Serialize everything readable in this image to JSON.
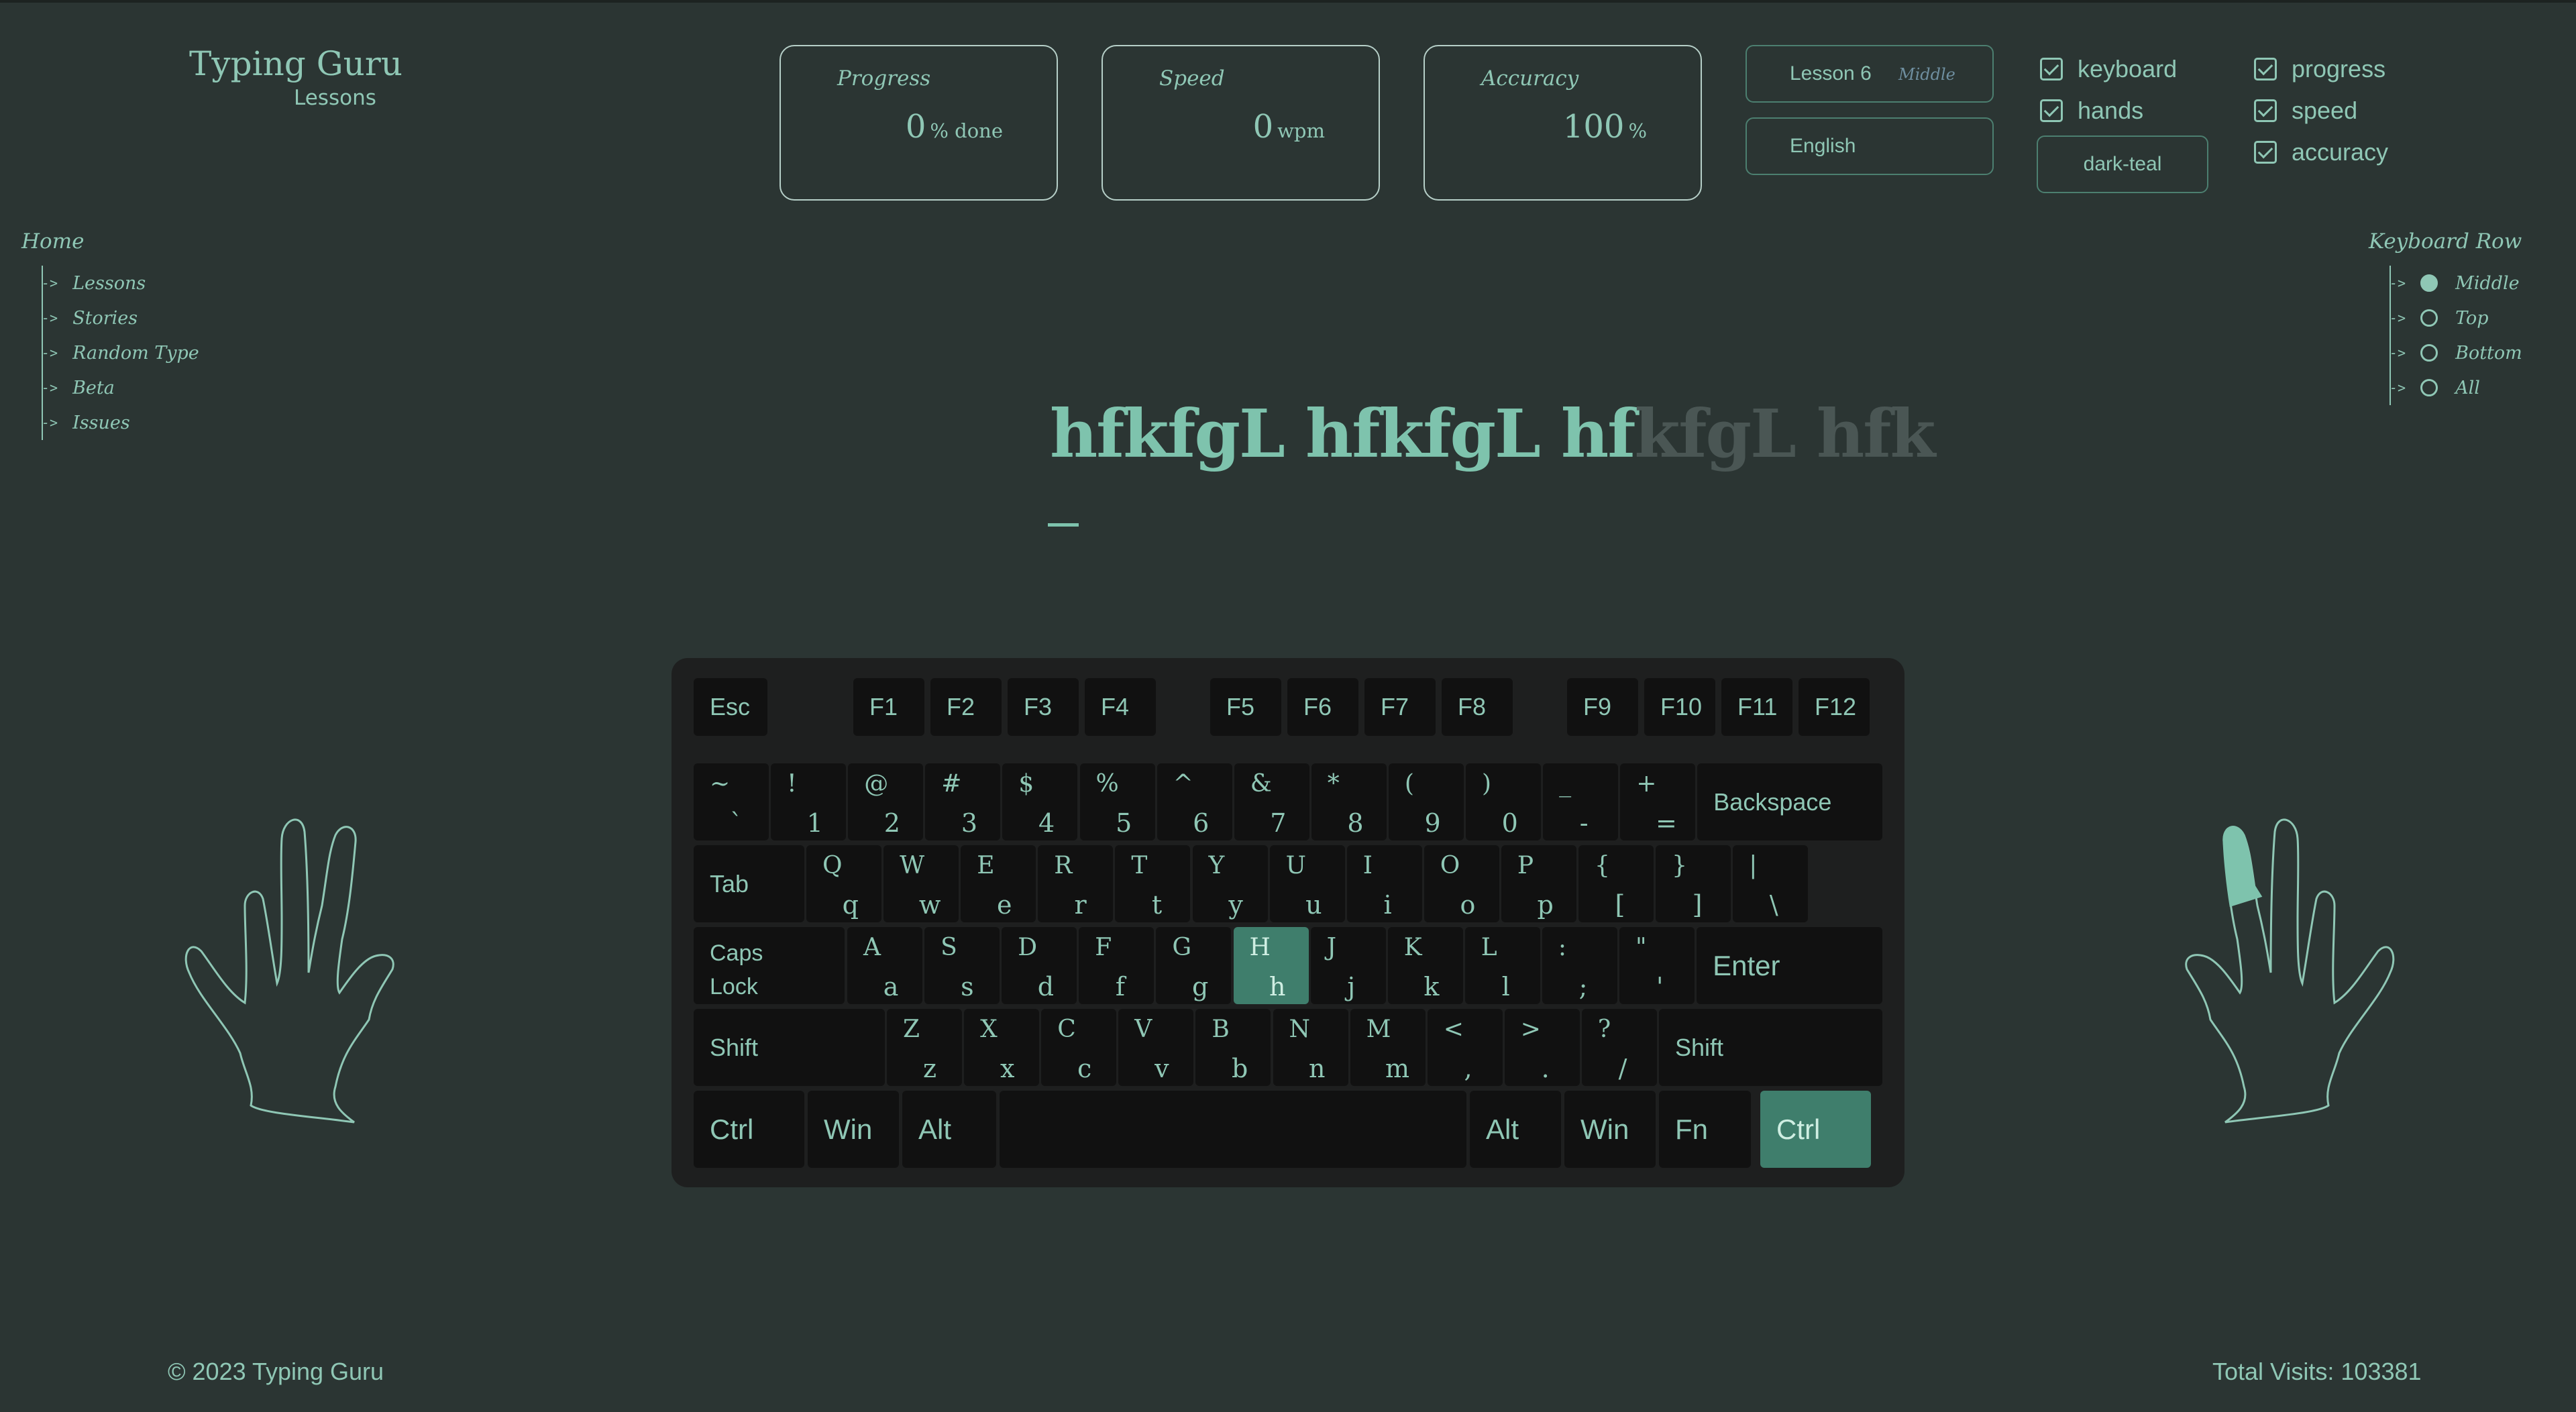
{
  "brand": {
    "title": "Typing Guru",
    "subtitle": "Lessons"
  },
  "stats": [
    {
      "label": "Progress",
      "value": "0",
      "unit": "% done"
    },
    {
      "label": "Speed",
      "value": "0",
      "unit": "wpm"
    },
    {
      "label": "Accuracy",
      "value": "100",
      "unit": "%"
    }
  ],
  "lesson": {
    "name": "Lesson 6",
    "row": "Middle",
    "language": "English",
    "theme": "dark-teal"
  },
  "toggles": {
    "col1": [
      {
        "label": "keyboard",
        "checked": true
      },
      {
        "label": "hands",
        "checked": true
      }
    ],
    "col2": [
      {
        "label": "progress",
        "checked": true
      },
      {
        "label": "speed",
        "checked": true
      },
      {
        "label": "accuracy",
        "checked": true
      }
    ]
  },
  "nav": {
    "title": "Home",
    "items": [
      "Lessons",
      "Stories",
      "Random Type",
      "Beta",
      "Issues"
    ]
  },
  "keyboard_row": {
    "title": "Keyboard Row",
    "options": [
      "Middle",
      "Top",
      "Bottom",
      "All"
    ],
    "selected": "Middle"
  },
  "typing": {
    "typed": "hfkfgL hfkfgL hf",
    "pending": "kfgL hfk"
  },
  "keys": {
    "fn_row": [
      "Esc",
      "F1",
      "F2",
      "F3",
      "F4",
      "F5",
      "F6",
      "F7",
      "F8",
      "F9",
      "F10",
      "F11",
      "F12"
    ],
    "number_row": [
      [
        "~",
        "`"
      ],
      [
        "!",
        "1"
      ],
      [
        "@",
        "2"
      ],
      [
        "#",
        "3"
      ],
      [
        "$",
        "4"
      ],
      [
        "%",
        "5"
      ],
      [
        "^",
        "6"
      ],
      [
        "&",
        "7"
      ],
      [
        "*",
        "8"
      ],
      [
        "(",
        "9"
      ],
      [
        ")",
        "0"
      ],
      [
        "_",
        "-"
      ],
      [
        "+",
        "="
      ]
    ],
    "backspace": "Backspace",
    "tab": "Tab",
    "top_row": [
      [
        "Q",
        "q"
      ],
      [
        "W",
        "w"
      ],
      [
        "E",
        "e"
      ],
      [
        "R",
        "r"
      ],
      [
        "T",
        "t"
      ],
      [
        "Y",
        "y"
      ],
      [
        "U",
        "u"
      ],
      [
        "I",
        "i"
      ],
      [
        "O",
        "o"
      ],
      [
        "P",
        "p"
      ],
      [
        "{",
        "["
      ],
      [
        "}",
        "]"
      ],
      [
        "|",
        "\\"
      ]
    ],
    "caps": [
      "Caps",
      "Lock"
    ],
    "home_row": [
      [
        "A",
        "a"
      ],
      [
        "S",
        "s"
      ],
      [
        "D",
        "d"
      ],
      [
        "F",
        "f"
      ],
      [
        "G",
        "g"
      ],
      [
        "H",
        "h"
      ],
      [
        "J",
        "j"
      ],
      [
        "K",
        "k"
      ],
      [
        "L",
        "l"
      ],
      [
        ":",
        ";"
      ],
      [
        "\"",
        "'"
      ]
    ],
    "enter": "Enter",
    "shift": "Shift",
    "bottom_row": [
      [
        "Z",
        "z"
      ],
      [
        "X",
        "x"
      ],
      [
        "C",
        "c"
      ],
      [
        "V",
        "v"
      ],
      [
        "B",
        "b"
      ],
      [
        "N",
        "n"
      ],
      [
        "M",
        "m"
      ],
      [
        "<",
        ","
      ],
      [
        ">",
        "."
      ],
      [
        "?",
        "/"
      ]
    ],
    "mods": {
      "ctrl": "Ctrl",
      "win": "Win",
      "alt": "Alt",
      "fn": "Fn"
    },
    "highlighted": [
      "H",
      "Right Ctrl"
    ]
  },
  "footer": {
    "copyright": "© 2023 Typing Guru",
    "visits": "Total Visits: 103381"
  },
  "colors": {
    "background": "#2b3533",
    "accent": "#8fc7b5",
    "key_lit": "#3f7e6c",
    "keyboard": "#1e1f1f",
    "key": "#111111"
  }
}
